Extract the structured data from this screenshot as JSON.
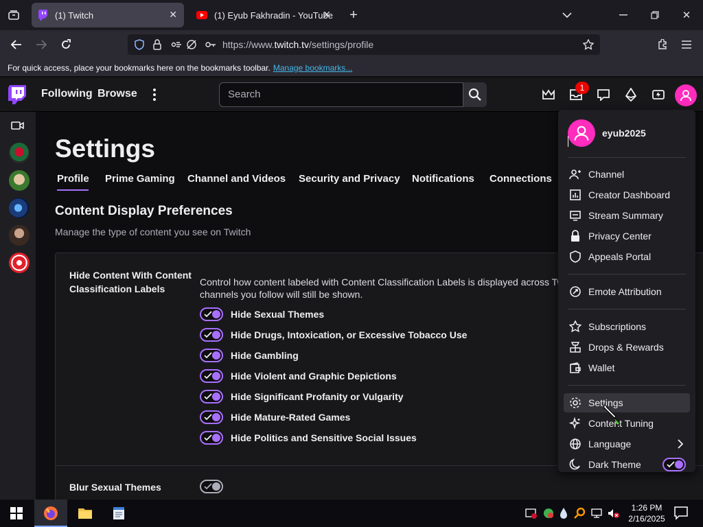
{
  "browser": {
    "tabs": [
      {
        "label": "(1) Twitch",
        "active": true
      },
      {
        "label": "(1) Eyub Fakhradin - YouTube",
        "active": false
      }
    ],
    "url_prefix": "https://www.",
    "url_domain": "twitch.tv",
    "url_path": "/settings/profile",
    "bookmarks_text": "For quick access, place your bookmarks here on the bookmarks toolbar.",
    "bookmarks_link": "Manage bookmarks..."
  },
  "twitch_nav": {
    "following": "Following",
    "browse": "Browse",
    "search_placeholder": "Search",
    "notification_count": "1"
  },
  "settings": {
    "title": "Settings",
    "tabs": [
      "Profile",
      "Prime Gaming",
      "Channel and Videos",
      "Security and Privacy",
      "Notifications",
      "Connections"
    ],
    "section_title": "Content Display Preferences",
    "section_desc": "Manage the type of content you see on Twitch",
    "card_label": "Hide Content With Content Classification Labels",
    "card_desc_line1": "Control how content labeled with Content Classification Labels is displayed across Tw",
    "card_desc_line2": "channels you follow will still be shown.",
    "toggles": [
      "Hide Sexual Themes",
      "Hide Drugs, Intoxication, or Excessive Tobacco Use",
      "Hide Gambling",
      "Hide Violent and Graphic Depictions",
      "Hide Significant Profanity or Vulgarity",
      "Hide Mature-Rated Games",
      "Hide Politics and Sensitive Social Issues"
    ],
    "blur_label": "Blur Sexual Themes"
  },
  "dropdown": {
    "username": "eyub2025",
    "items": [
      {
        "label": "Channel",
        "icon": "person-icon"
      },
      {
        "label": "Creator Dashboard",
        "icon": "dashboard-icon"
      },
      {
        "label": "Stream Summary",
        "icon": "summary-icon"
      },
      {
        "label": "Privacy Center",
        "icon": "lock-icon"
      },
      {
        "label": "Appeals Portal",
        "icon": "shield-icon"
      },
      {
        "label": "Emote Attribution",
        "icon": "emote-icon"
      },
      {
        "label": "Subscriptions",
        "icon": "star-icon"
      },
      {
        "label": "Drops & Rewards",
        "icon": "drops-icon"
      },
      {
        "label": "Wallet",
        "icon": "wallet-icon"
      },
      {
        "label": "Settings",
        "icon": "gear-icon"
      },
      {
        "label": "Content Tuning",
        "icon": "sparkle-icon"
      },
      {
        "label": "Language",
        "icon": "globe-icon"
      },
      {
        "label": "Dark Theme",
        "icon": "moon-icon"
      }
    ]
  },
  "taskbar": {
    "time": "1:26 PM",
    "date": "2/16/2025"
  },
  "colors": {
    "accent": "#a970ff",
    "brand": "#9146ff",
    "avatar": "#ff2cbd",
    "background": "#0e0e10"
  }
}
